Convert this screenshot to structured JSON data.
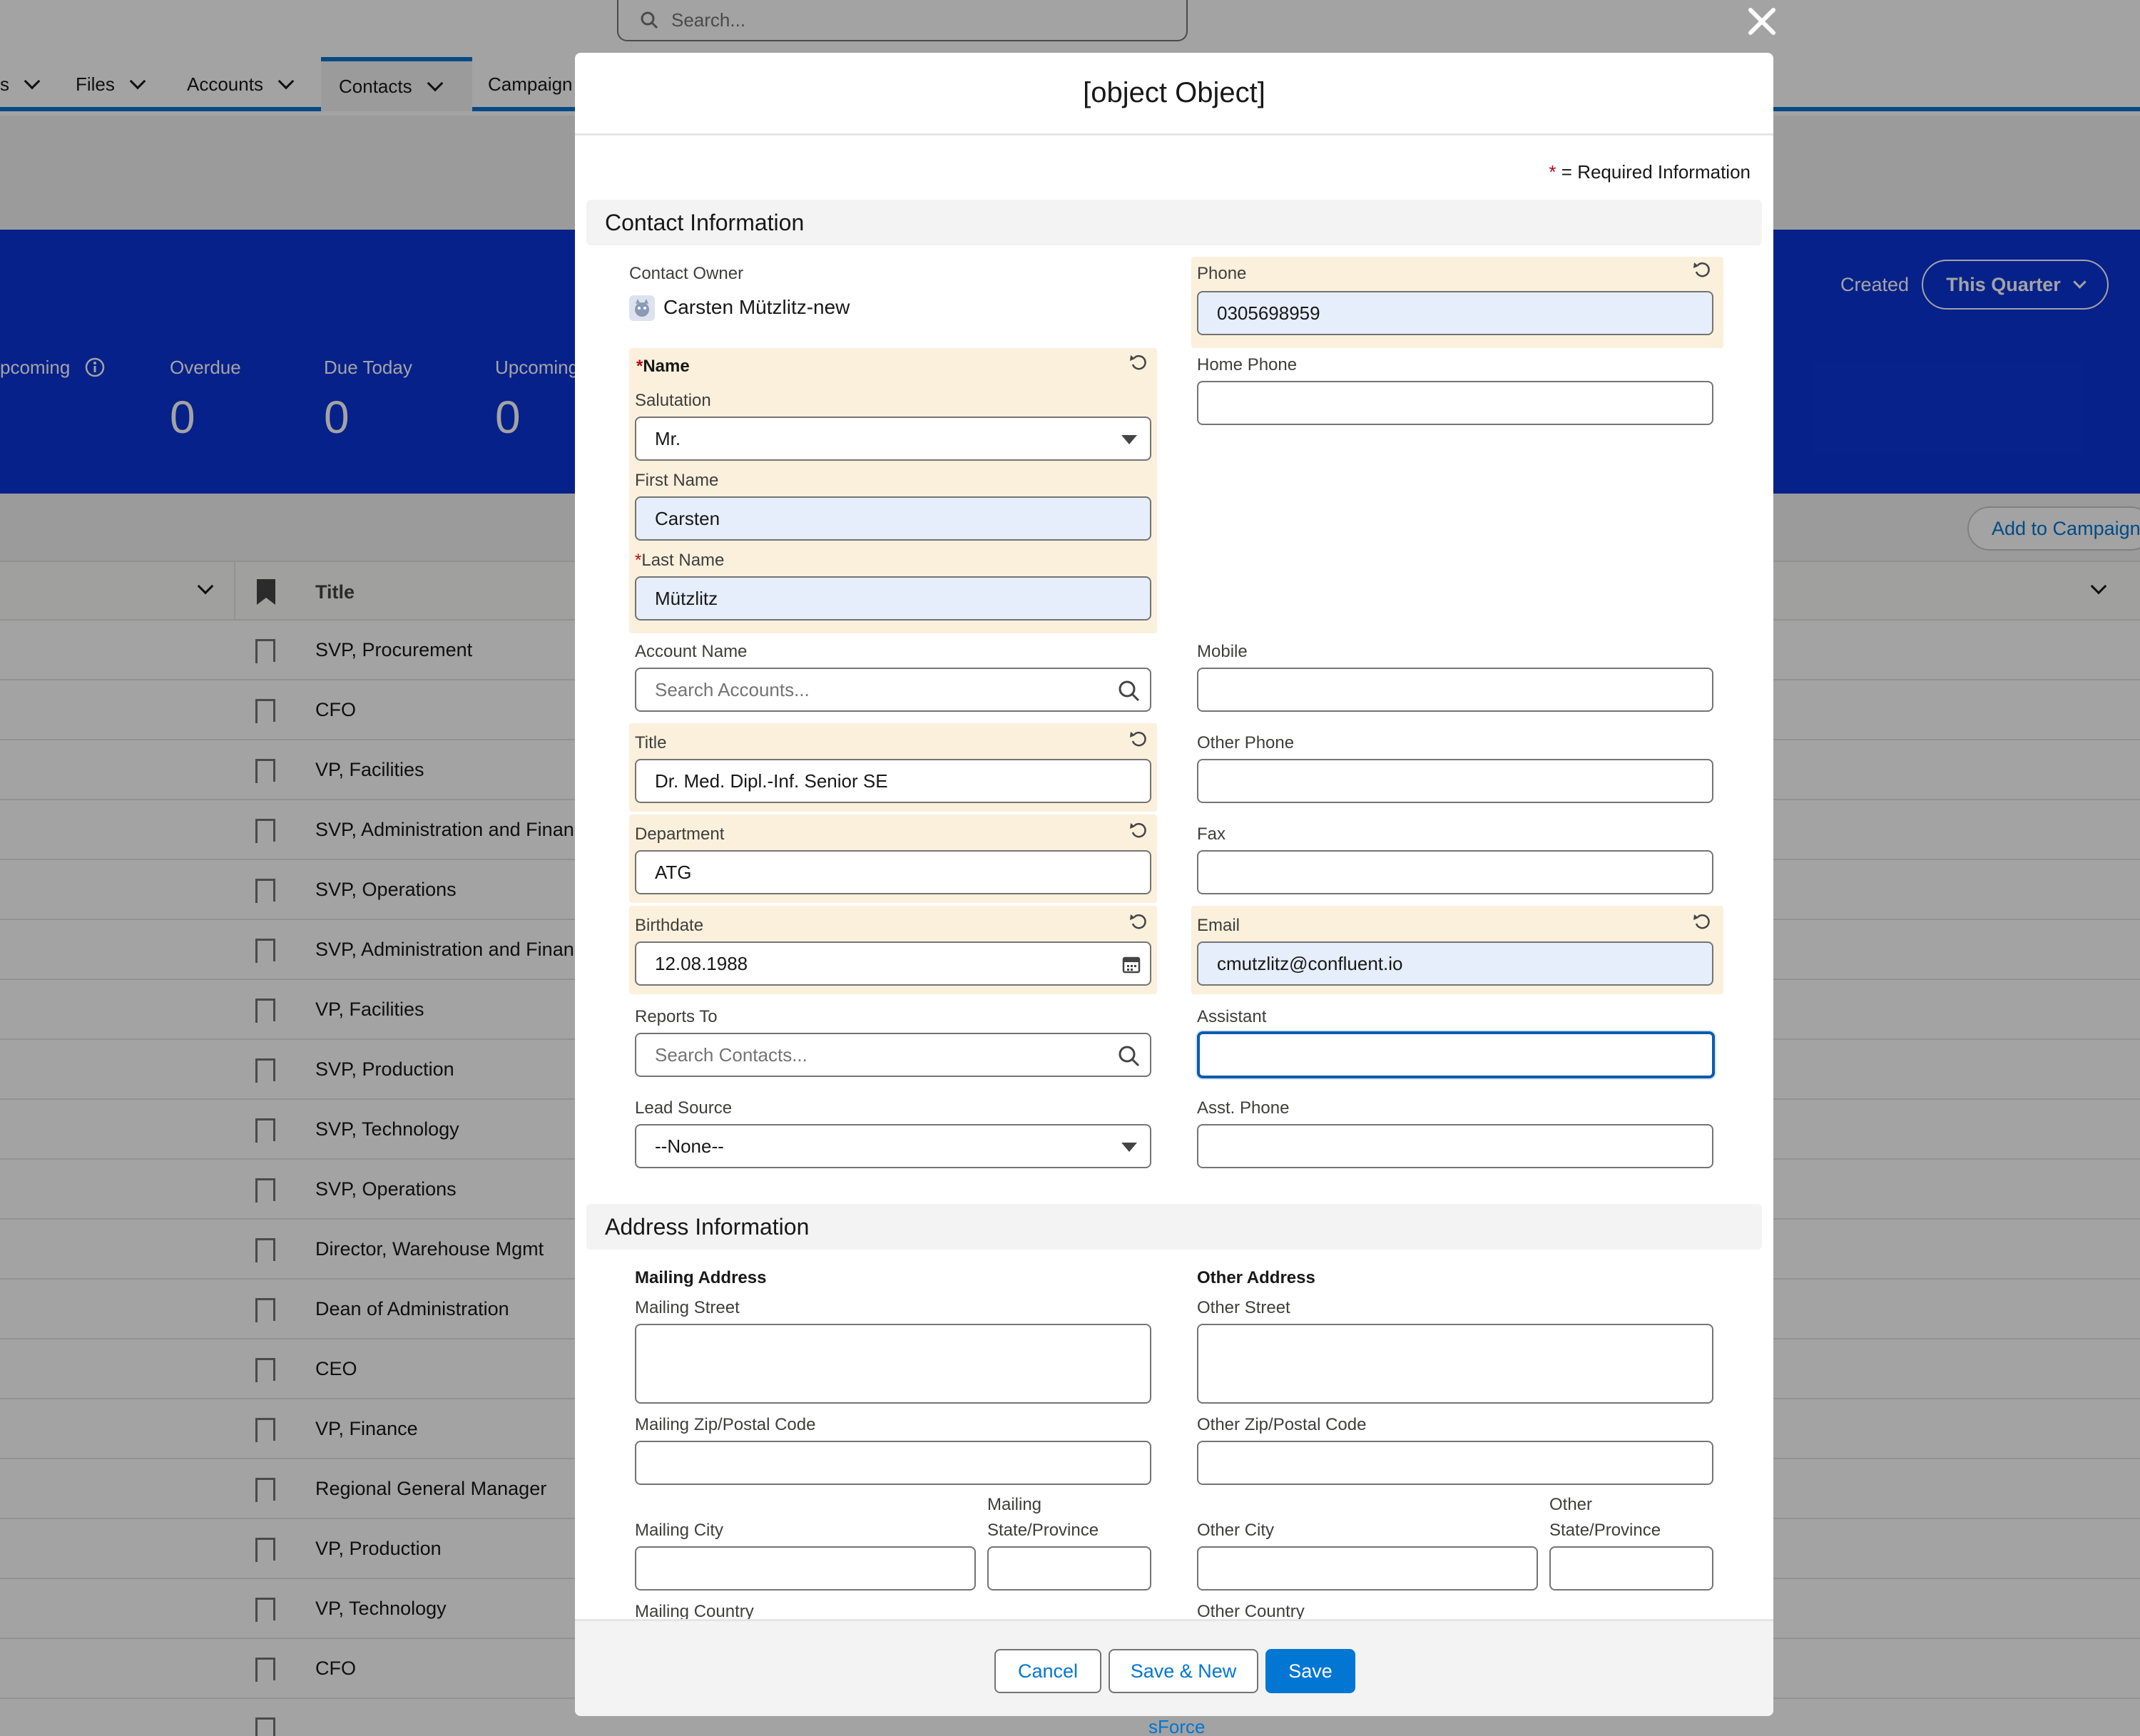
{
  "global_search": {
    "placeholder": "Search..."
  },
  "nav": {
    "items": [
      {
        "label": "s"
      },
      {
        "label": "Files"
      },
      {
        "label": "Accounts"
      },
      {
        "label": "Contacts"
      },
      {
        "label": "Campaign"
      }
    ],
    "active": "Contacts"
  },
  "activity_panel": {
    "kpis": [
      {
        "label": "pcoming",
        "value": ""
      },
      {
        "label": "Overdue",
        "value": "0"
      },
      {
        "label": "Due Today",
        "value": "0"
      },
      {
        "label": "Upcoming",
        "value": "0"
      }
    ],
    "created_label": "Created",
    "filter_label": "This Quarter"
  },
  "list": {
    "add_to_campaign": "Add to Campaign",
    "title_header": "Title",
    "rows": [
      "SVP, Procurement",
      "CFO",
      "VP, Facilities",
      "SVP, Administration and Finance",
      "SVP, Operations",
      "SVP, Administration and Finance",
      "VP, Facilities",
      "SVP, Production",
      "SVP, Technology",
      "SVP, Operations",
      "Director, Warehouse Mgmt",
      "Dean of Administration",
      "CEO",
      "VP, Finance",
      "Regional General Manager",
      "VP, Production",
      "VP, Technology",
      "CFO"
    ]
  },
  "modal": {
    "title": {
      "label": "Title",
      "value": "Dr. Med. Dipl.-Inf. Senior SE"
    },
    "required_note": "= Required Information",
    "sections": {
      "contact": "Contact Information",
      "address": "Address Information"
    },
    "contact_owner": {
      "label": "Contact Owner",
      "value": "Carsten Mützlitz-new"
    },
    "name": {
      "label": "Name"
    },
    "salutation": {
      "label": "Salutation",
      "value": "Mr."
    },
    "first_name": {
      "label": "First Name",
      "value": "Carsten"
    },
    "last_name": {
      "label": "Last Name",
      "value": "Mützlitz"
    },
    "account_name": {
      "label": "Account Name",
      "placeholder": "Search Accounts..."
    },
    "department": {
      "label": "Department",
      "value": "ATG"
    },
    "birthdate": {
      "label": "Birthdate",
      "value": "12.08.1988"
    },
    "reports_to": {
      "label": "Reports To",
      "placeholder": "Search Contacts..."
    },
    "lead_source": {
      "label": "Lead Source",
      "value": "--None--"
    },
    "phone": {
      "label": "Phone",
      "value": "0305698959"
    },
    "home_phone": {
      "label": "Home Phone",
      "value": ""
    },
    "mobile": {
      "label": "Mobile",
      "value": ""
    },
    "other_phone": {
      "label": "Other Phone",
      "value": ""
    },
    "fax": {
      "label": "Fax",
      "value": ""
    },
    "email": {
      "label": "Email",
      "value": "cmutzlitz@confluent.io"
    },
    "assistant": {
      "label": "Assistant",
      "value": ""
    },
    "asst_phone": {
      "label": "Asst. Phone",
      "value": ""
    },
    "mailing": {
      "heading": "Mailing Address",
      "street": "Mailing Street",
      "zip": "Mailing Zip/Postal Code",
      "city": "Mailing City",
      "state_1": "Mailing",
      "state_2": "State/Province",
      "country": "Mailing Country"
    },
    "other": {
      "heading": "Other Address",
      "street": "Other Street",
      "zip": "Other Zip/Postal Code",
      "city": "Other City",
      "state_1": "Other",
      "state_2": "State/Province",
      "country": "Other Country"
    },
    "buttons": {
      "cancel": "Cancel",
      "save_new": "Save & New",
      "save": "Save"
    }
  },
  "footer_link": "sForce"
}
